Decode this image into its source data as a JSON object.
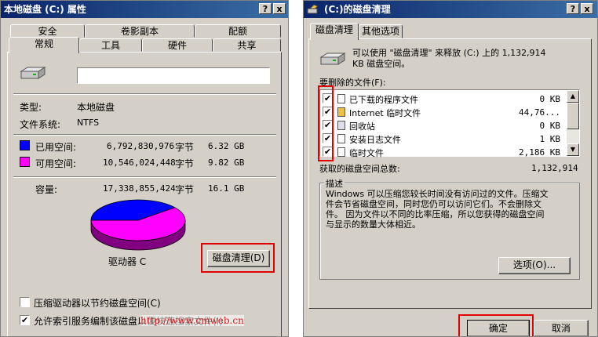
{
  "left": {
    "title": "本地磁盘 (C:) 属性",
    "tabs_top": [
      "安全",
      "卷影副本",
      "配额"
    ],
    "tabs_bottom": [
      "常规",
      "工具",
      "硬件",
      "共享"
    ],
    "name_value": "",
    "type_label": "类型:",
    "type_value": "本地磁盘",
    "fs_label": "文件系统:",
    "fs_value": "NTFS",
    "used": {
      "label": "已用空间:",
      "bytes": "6,792,830,976",
      "unit": "字节",
      "size": "6.32 GB",
      "color": "#0000ff"
    },
    "free": {
      "label": "可用空间:",
      "bytes": "10,546,024,448",
      "unit": "字节",
      "size": "9.82 GB",
      "color": "#ff00ff"
    },
    "capacity": {
      "label": "容量:",
      "bytes": "17,338,855,424",
      "unit": "字节",
      "size": "16.1 GB"
    },
    "drive_label": "驱动器 C",
    "cleanup_button": "磁盘清理(D)",
    "compress_label": "压缩驱动器以节约磁盘空间(C)",
    "index_label": "允许索引服务编制该磁盘以便快速搜索文件(I)",
    "compress_checked": false,
    "index_checked": true,
    "watermark": "http://www.cmweb.cn",
    "used_fraction": 0.392
  },
  "right": {
    "title": "(C:)的磁盘清理",
    "tabs": [
      "磁盘清理",
      "其他选项"
    ],
    "intro_line1": "可以使用 \"磁盘清理\" 来释放 (C:) 上的 1,132,914",
    "intro_line2": "KB 磁盘空间。",
    "files_label": "要删除的文件(F):",
    "files": [
      {
        "name": "已下载的程序文件",
        "size": "0 KB",
        "checked": true
      },
      {
        "name": "Internet 临时文件",
        "size": "44,76...",
        "checked": true
      },
      {
        "name": "回收站",
        "size": "0 KB",
        "checked": true
      },
      {
        "name": "安装日志文件",
        "size": "1 KB",
        "checked": true
      },
      {
        "name": "临时文件",
        "size": "2,186 KB",
        "checked": true
      }
    ],
    "total_label": "获取的磁盘空间总数:",
    "total_value": "1,132,914",
    "desc_label": "描述",
    "desc_lines": [
      "Windows 可以压缩您较长时间没有访问过的文件。压缩文",
      "件会节省磁盘空间，同时您仍可以访问它们。不会删除文",
      "件。 因为文件以不同的比率压缩，所以您获得的磁盘空间",
      "与显示的数量大体相近。"
    ],
    "options_button": "选项(O)...",
    "ok_button": "确定",
    "cancel_button": "取消"
  },
  "icons": {
    "help": "?",
    "close": "x",
    "check": "✔",
    "scroll_up": "▲",
    "scroll_down": "▼"
  }
}
